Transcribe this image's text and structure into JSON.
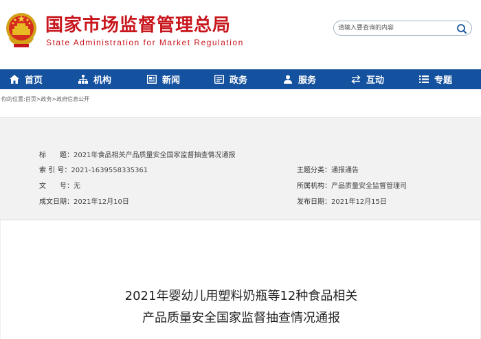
{
  "header": {
    "title": "国家市场监督管理总局",
    "subtitle": "State Administration for Market Regulation",
    "search_placeholder": "请输入要查询的内容"
  },
  "nav": {
    "items": [
      {
        "label": "首页",
        "icon": "home-icon"
      },
      {
        "label": "机构",
        "icon": "org-chart-icon"
      },
      {
        "label": "新闻",
        "icon": "news-icon"
      },
      {
        "label": "政务",
        "icon": "government-affairs-icon"
      },
      {
        "label": "服务",
        "icon": "service-icon"
      },
      {
        "label": "互动",
        "icon": "interaction-icon"
      },
      {
        "label": "专题",
        "icon": "topics-icon"
      }
    ]
  },
  "breadcrumb": {
    "prefix": "你的位置:",
    "items": [
      "首页",
      "政务",
      "政府信息公开"
    ],
    "separator": ">"
  },
  "meta": {
    "title_label": "标　　题：",
    "title_value": "2021年食品相关产品质量安全国家监督抽查情况通报",
    "index_label": "索 引 号：",
    "index_value": "2021-1639558335361",
    "doc_no_label": "文　　号：",
    "doc_no_value": "无",
    "created_label": "成文日期：",
    "created_value": "2021年12月10日",
    "category_label": "主题分类：",
    "category_value": "通报通告",
    "agency_label": "所属机构：",
    "agency_value": "产品质量安全监督管理司",
    "published_label": "发布日期：",
    "published_value": "2021年12月15日"
  },
  "article": {
    "title_line1": "2021年婴幼儿用塑料奶瓶等12种食品相关",
    "title_line2": "产品质量安全国家监督抽查情况通报"
  },
  "colors": {
    "brand_red": "#c8161d",
    "nav_blue": "#14519e",
    "panel_gray": "#f2f2f2"
  }
}
